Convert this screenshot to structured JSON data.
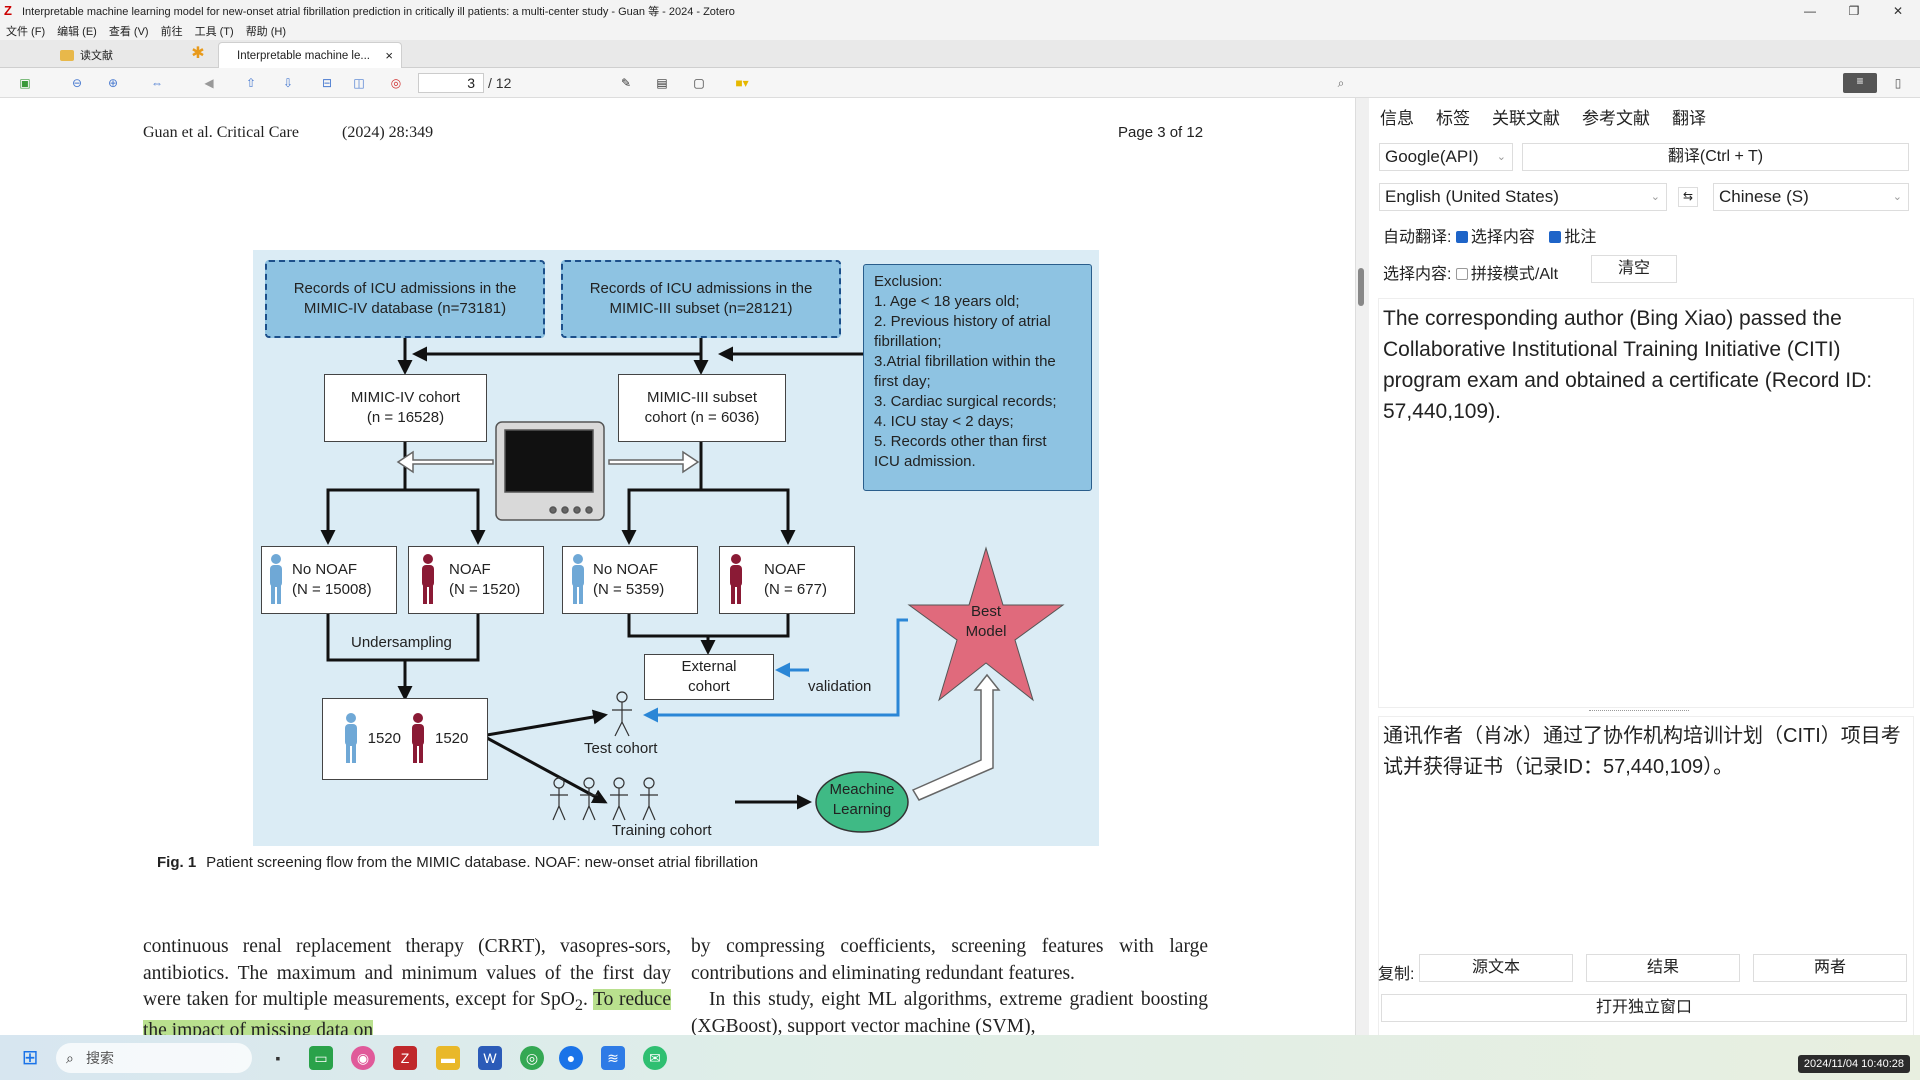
{
  "window": {
    "title": "Interpretable machine learning model for new-onset atrial fibrillation prediction in critically ill patients: a multi-center study - Guan 等 - 2024 - Zotero",
    "icon": "zotero-icon"
  },
  "menu": [
    "文件 (F)",
    "编辑 (E)",
    "查看 (V)",
    "前往",
    "工具 (T)",
    "帮助 (H)"
  ],
  "tabs": {
    "library": "读文献",
    "reader": "Interpretable machine le..."
  },
  "toolbar": {
    "page_current": "3",
    "page_total": "/ 12"
  },
  "paper": {
    "header_left": "Guan et al. Critical Care",
    "header_year": "(2024) 28:349",
    "header_right": "Page 3 of 12",
    "caption_label": "Fig. 1",
    "caption_text": "Patient screening flow from the MIMIC database. NOAF: new-onset atrial fibrillation",
    "col_left_1": "continuous renal replacement therapy (CRRT), vasopres-sors, antibiotics. The maximum and minimum values of the first day were taken for multiple measurements, except for SpO",
    "col_left_sub": "2",
    "col_left_2": ". ",
    "col_left_hl": "To reduce the impact of missing data on",
    "col_right": "by compressing coefficients, screening features with large contributions and eliminating redundant features.",
    "col_right_2": "In this study, eight ML algorithms, extreme gradient boosting (XGBoost), support vector machine (SVM),"
  },
  "figure": {
    "mimic4_records": [
      "Records of ICU admissions in the",
      "MIMIC-IV database (n=73181)"
    ],
    "mimic3_records": [
      "Records of ICU admissions in the",
      "MIMIC-III subset (n=28121)"
    ],
    "exclusion": [
      "Exclusion:",
      "1. Age < 18 years old;",
      "2. Previous history of atrial",
      "fibrillation;",
      "3.Atrial fibrillation within the",
      "first day;",
      "3. Cardiac surgical records;",
      "4. ICU stay < 2 days;",
      "5. Records other than first",
      "ICU admission."
    ],
    "mimic4_cohort": [
      "MIMIC-IV cohort",
      "(n = 16528)"
    ],
    "mimic3_cohort": [
      "MIMIC-III subset",
      "cohort (n = 6036)"
    ],
    "no_noaf_4": [
      "No NOAF",
      "(N = 15008)"
    ],
    "noaf_4": [
      "NOAF",
      "(N = 1520)"
    ],
    "no_noaf_3": [
      "No NOAF",
      "(N = 5359)"
    ],
    "noaf_3": [
      "NOAF",
      "(N = 677)"
    ],
    "undersampling": "Undersampling",
    "balanced_a": "1520",
    "balanced_b": "1520",
    "external": [
      "External",
      "cohort"
    ],
    "validation": "validation",
    "best_model": [
      "Best",
      "Model"
    ],
    "test_cohort": "Test cohort",
    "training_cohort": "Training cohort",
    "ml": [
      "Meachine",
      "Learning"
    ]
  },
  "right": {
    "tabs": [
      "信息",
      "标签",
      "关联文献",
      "参考文献",
      "翻译"
    ],
    "engine": "Google(API)",
    "translate_btn": "翻译(Ctrl + T)",
    "src_lang": "English (United States)",
    "dst_lang": "Chinese (S)",
    "auto_label": "自动翻译:",
    "auto_sel": "选择内容",
    "auto_note": "批注",
    "sel_label": "选择内容:",
    "sel_concat": "拼接模式/Alt",
    "clear_btn": "清空",
    "source_text": "The corresponding author (Bing Xiao) passed the Collaborative Institutional Training Initiative (CITI) program exam and obtained a certificate (Record ID: 57,440,109).",
    "result_text": "通讯作者（肖冰）通过了协作机构培训计划（CITI）项目考试并获得证书（记录ID：57,440,109）。",
    "copy_label": "复制:",
    "copy_src": "源文本",
    "copy_res": "结果",
    "copy_both": "两者",
    "open_window": "打开独立窗口"
  },
  "taskbar": {
    "search": "搜索",
    "clock": "2024/11/04 10:40:28"
  }
}
